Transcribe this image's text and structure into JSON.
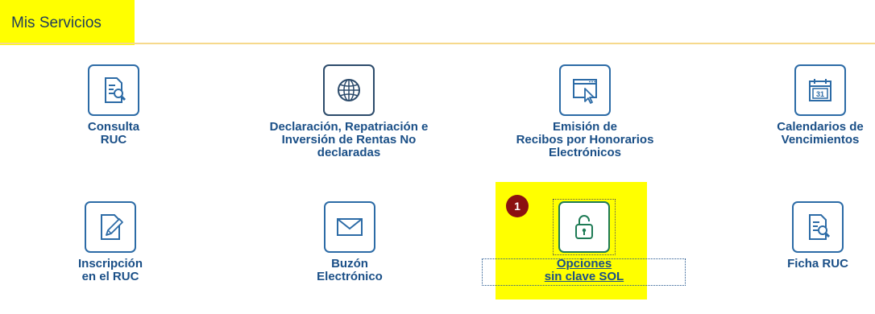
{
  "header": {
    "title": "Mis Servicios"
  },
  "badge": {
    "number": "1"
  },
  "services": [
    {
      "label": "Consulta\nRUC",
      "icon": "search-document-icon"
    },
    {
      "label": "Declaración, Repatriación e\nInversión de Rentas No\ndeclaradas",
      "icon": "globe-icon"
    },
    {
      "label": "Emisión de\nRecibos por Honorarios\nElectrónicos",
      "icon": "browser-cursor-icon"
    },
    {
      "label": "Calendarios de\nVencimientos",
      "icon": "calendar-icon"
    },
    {
      "label": "Inscripción\nen el RUC",
      "icon": "edit-document-icon"
    },
    {
      "label": "Buzón\nElectrónico",
      "icon": "envelope-icon"
    },
    {
      "label": "Opciones\nsin clave SOL",
      "icon": "unlocked-padlock-icon"
    },
    {
      "label": "Ficha RUC",
      "icon": "search-document-icon"
    }
  ],
  "calendar_icon_text": "31",
  "colors": {
    "highlight": "#ffff00",
    "label": "#1a4f87",
    "icon_border": "#2c6ba6",
    "badge": "#8b1111",
    "header_rule": "#f6d98c"
  }
}
